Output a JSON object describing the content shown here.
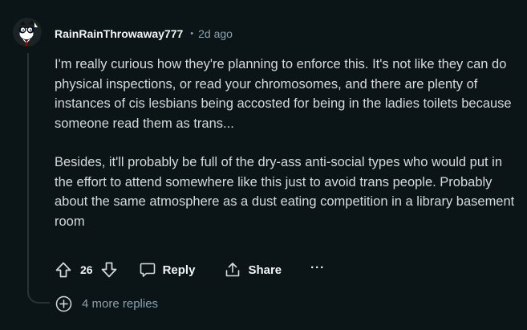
{
  "comment": {
    "username": "RainRainThrowaway777",
    "separator": "•",
    "timestamp": "2d ago",
    "paragraphs": [
      "I'm really curious how they're planning to enforce this. It's not like they can do physical inspections, or read your chromosomes, and there are plenty of instances of cis lesbians being accosted for being in the ladies toilets because someone read them as trans...",
      "Besides, it'll probably be full of the dry-ass anti-social types who would put in the effort to attend somewhere like this just to avoid trans people. Probably about the same atmosphere as a dust eating competition in a library basement room"
    ],
    "avatar_icon": "snoo-avatar-icon"
  },
  "actions": {
    "upvote_icon": "arrow-up-icon",
    "score": "26",
    "downvote_icon": "arrow-down-icon",
    "reply_label": "Reply",
    "reply_icon": "speech-bubble-icon",
    "share_label": "Share",
    "share_icon": "share-icon",
    "more_label": "···"
  },
  "more_replies": {
    "icon": "plus-circle-icon",
    "label": "4 more replies"
  },
  "colors": {
    "background": "#0b1416",
    "text": "#d7dadc",
    "muted": "#8ba2ad",
    "thread_line": "#2a3236"
  }
}
